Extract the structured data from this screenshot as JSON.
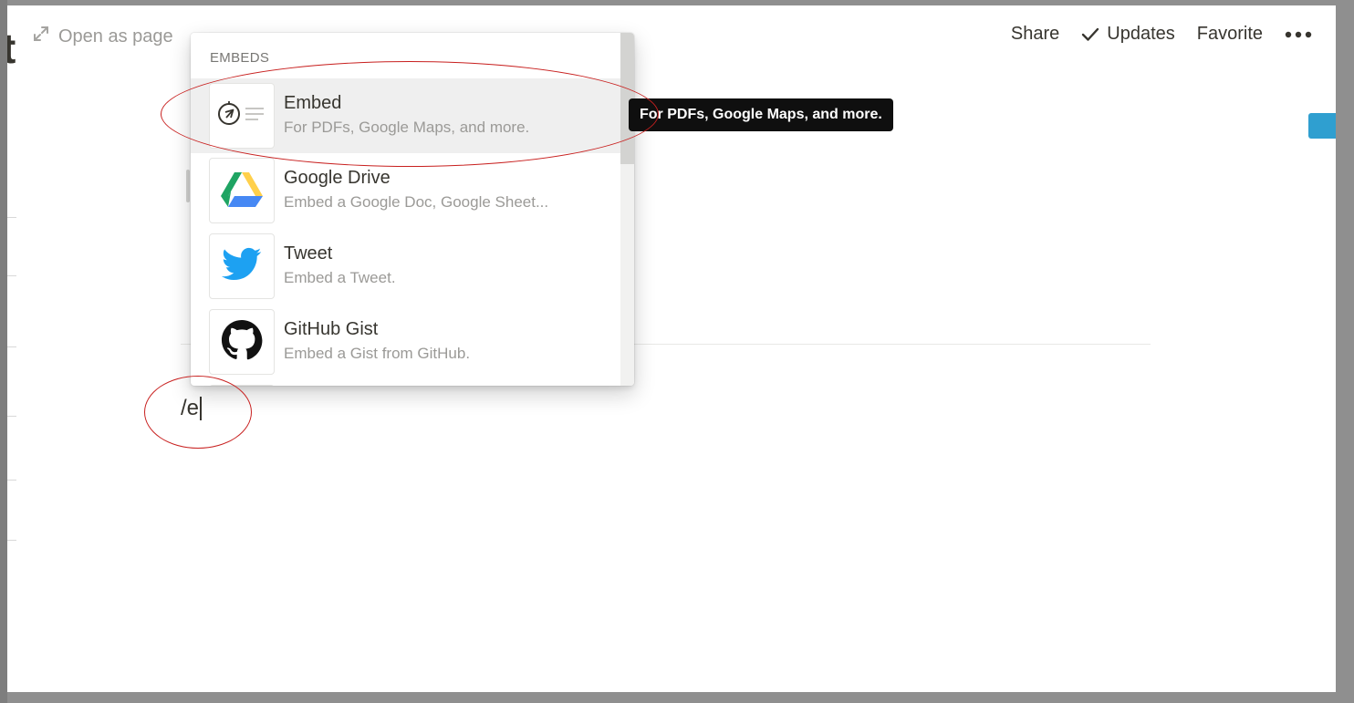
{
  "toolbar": {
    "open_as_page_label": "Open as page",
    "share_label": "Share",
    "updates_label": "Updates",
    "favorite_label": "Favorite",
    "more_icon": "more-horizontal-icon"
  },
  "editor": {
    "typed_text": "/e"
  },
  "menu": {
    "section_label": "EMBEDS",
    "items": [
      {
        "title": "Embed",
        "description": "For PDFs, Google Maps, and more.",
        "icon": "compass-embed-icon",
        "selected": true
      },
      {
        "title": "Google Drive",
        "description": "Embed a Google Doc, Google Sheet...",
        "icon": "google-drive-icon",
        "selected": false
      },
      {
        "title": "Tweet",
        "description": "Embed a Tweet.",
        "icon": "twitter-bird-icon",
        "selected": false
      },
      {
        "title": "GitHub Gist",
        "description": "Embed a Gist from GitHub.",
        "icon": "github-icon",
        "selected": false
      }
    ]
  },
  "tooltip": {
    "text": "For PDFs, Google Maps, and more."
  },
  "colors": {
    "annotation": "#c8201f",
    "twitter_blue": "#1da1f2",
    "drive_green": "#1fa463",
    "drive_yellow": "#ffd04b",
    "drive_blue": "#4688f4",
    "text_primary": "#37352f",
    "text_muted": "#9b9a97"
  }
}
